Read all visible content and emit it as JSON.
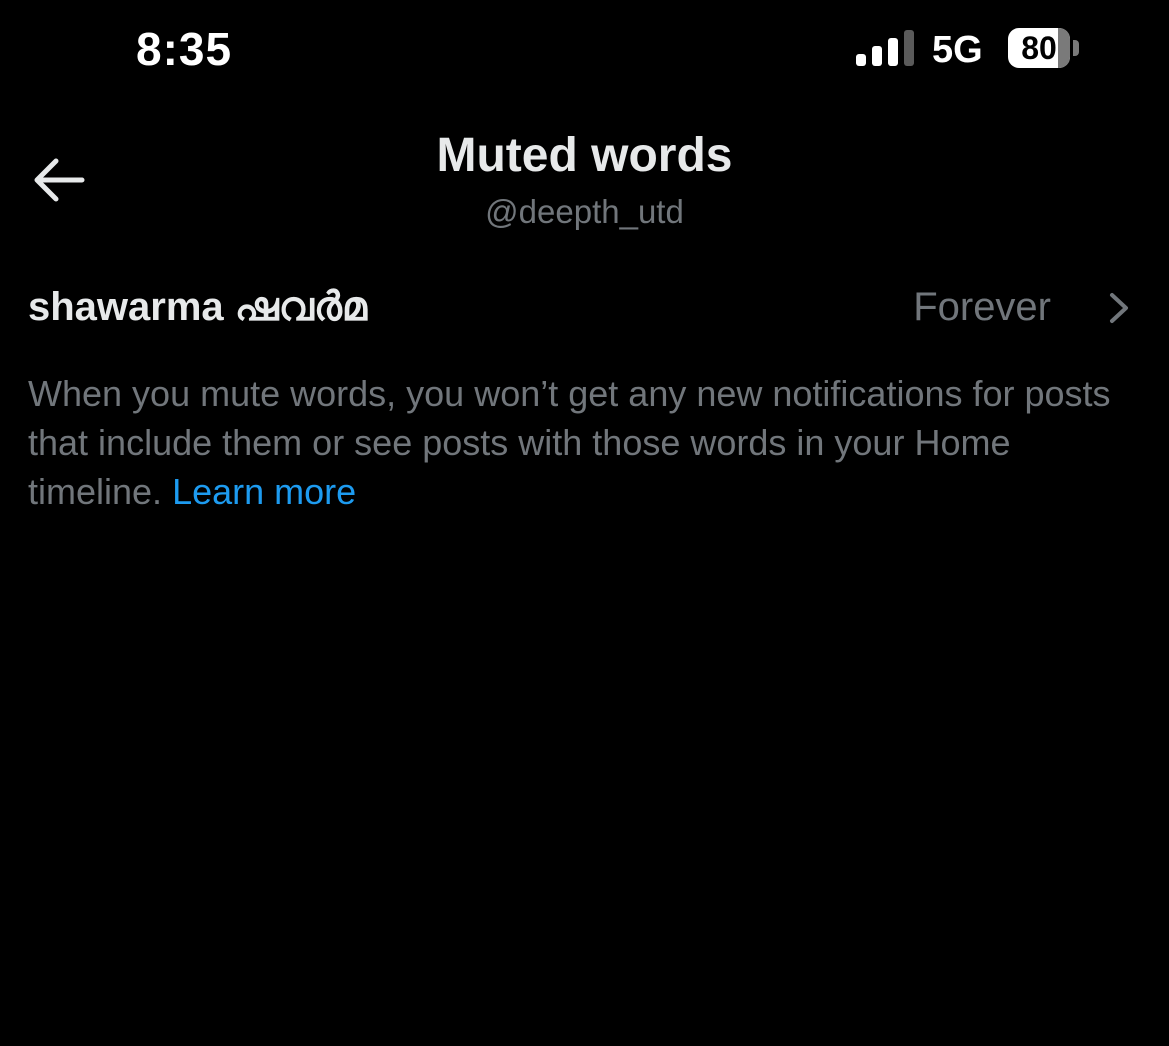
{
  "status_bar": {
    "time": "8:35",
    "network": "5G",
    "battery_level": "80",
    "battery_fraction": 0.8,
    "signal_bars_active": 3,
    "signal_bars_total": 4
  },
  "header": {
    "back_icon": "arrow-left-icon",
    "title": "Muted words",
    "subtitle": "@deepth_utd"
  },
  "muted_words": [
    {
      "word": "shawarma ഷവർമ",
      "duration": "Forever",
      "icon": "chevron-right-icon"
    }
  ],
  "description": {
    "text": "When you mute words, you won’t get any new notifications for posts that include them or see posts with those words in your Home timeline.",
    "link_label": "Learn more"
  },
  "colors": {
    "background": "#000000",
    "primary_text": "#e7e9ea",
    "secondary_text": "#71767b",
    "link": "#1d9bf0"
  }
}
